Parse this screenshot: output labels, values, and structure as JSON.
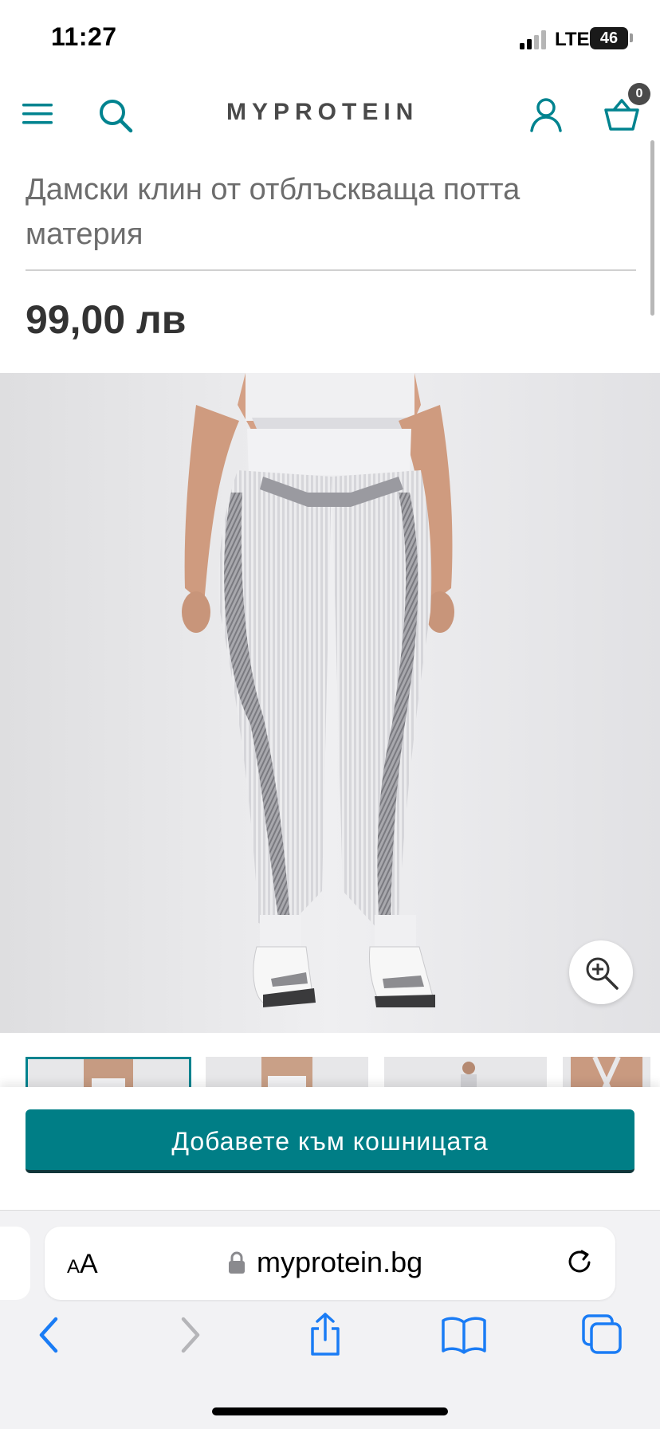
{
  "status_bar": {
    "time": "11:27",
    "network": "LTE",
    "battery": "46"
  },
  "header": {
    "logo": "MYPROTEIN",
    "basket_count": "0",
    "accent_color": "#00838f"
  },
  "product": {
    "title": "Дамски клин от отблъскваща потта материя",
    "price": "99,00 лв"
  },
  "gallery": {
    "thumbnails": [
      "thumbnail-1",
      "thumbnail-2",
      "thumbnail-3",
      "thumbnail-4"
    ],
    "selected_index": 0
  },
  "cta": {
    "add_to_basket_label": "Добавете към кошницата",
    "color": "#007e86"
  },
  "browser": {
    "text_size_small": "A",
    "text_size_large": "A",
    "url": "myprotein.bg"
  }
}
